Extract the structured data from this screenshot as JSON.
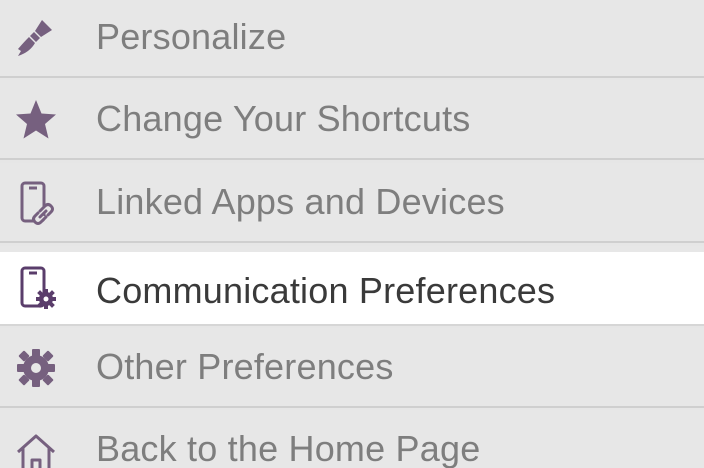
{
  "colors": {
    "icon_purple": "#76607f",
    "active_icon_purple": "#5a3d6b",
    "item_background": "#e7e7e7",
    "active_background": "#ffffff",
    "text_inactive": "#7e7e7e",
    "text_active": "#3a3a3a"
  },
  "menu": {
    "items": [
      {
        "label": "Personalize",
        "icon": "paintbrush-icon",
        "active": false
      },
      {
        "label": "Change Your Shortcuts",
        "icon": "star-icon",
        "active": false
      },
      {
        "label": "Linked Apps and Devices",
        "icon": "phone-link-icon",
        "active": false
      },
      {
        "label": "Communication Preferences",
        "icon": "phone-gear-icon",
        "active": true
      },
      {
        "label": "Other Preferences",
        "icon": "gear-icon",
        "active": false
      },
      {
        "label": "Back to the Home Page",
        "icon": "home-icon",
        "active": false
      }
    ]
  }
}
